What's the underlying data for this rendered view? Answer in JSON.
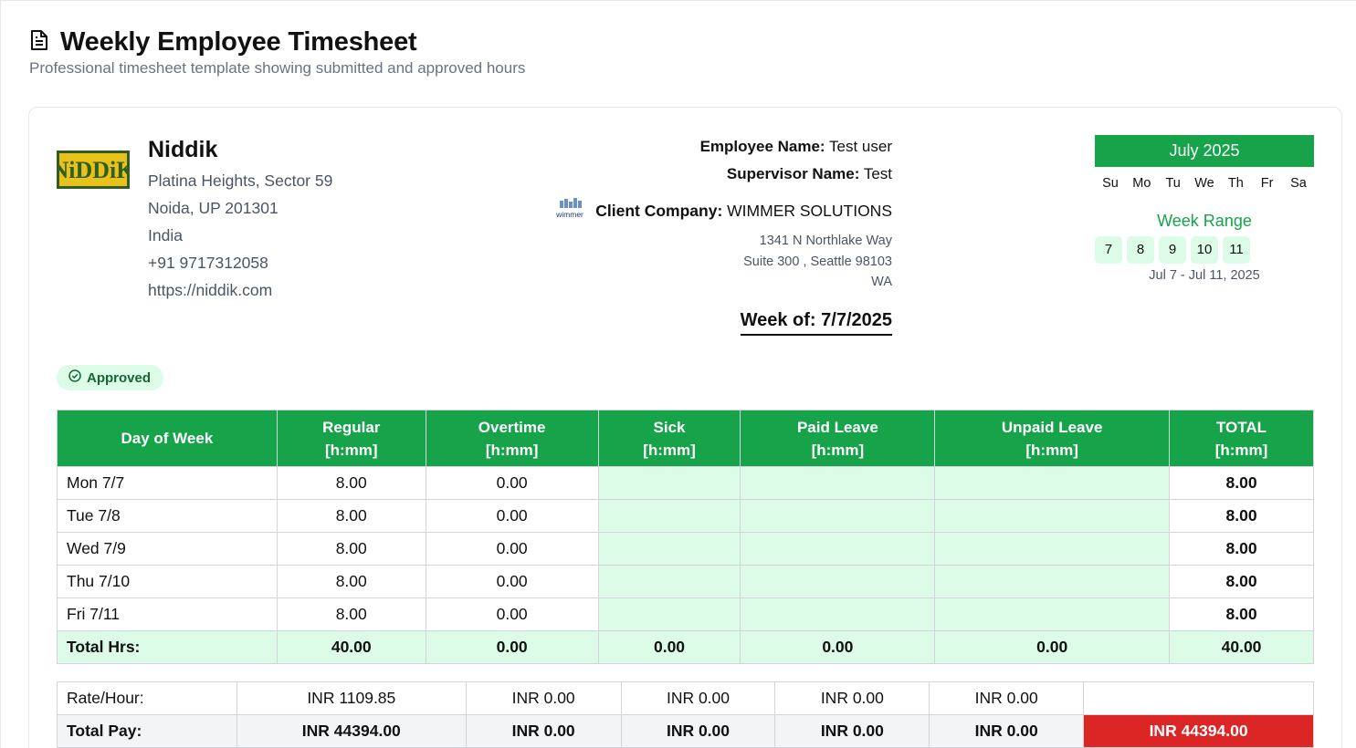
{
  "page": {
    "title": "Weekly Employee Timesheet",
    "subtitle": "Professional timesheet template showing submitted and approved hours",
    "title_icon": "document-icon"
  },
  "company": {
    "logo_text": "NiDDiK",
    "name": "Niddik",
    "address_line1": "Platina Heights, Sector 59",
    "address_line2": "Noida, UP 201301",
    "country": "India",
    "phone": "+91 9717312058",
    "website": "https://niddik.com"
  },
  "employee": {
    "employee_label": "Employee Name:",
    "employee_value": "Test user",
    "supervisor_label": "Supervisor Name:",
    "supervisor_value": "Test",
    "client_label": "Client Company:",
    "client_value": "WIMMER SOLUTIONS",
    "client_logo_text": "wimmer",
    "client_address1": "1341 N Northlake Way",
    "client_address2": "Suite 300 , Seattle 98103",
    "client_address3": "WA",
    "week_of_label": "Week of:",
    "week_of_value": "7/7/2025"
  },
  "calendar": {
    "month": "July 2025",
    "weekdays": [
      "Su",
      "Mo",
      "Tu",
      "We",
      "Th",
      "Fr",
      "Sa"
    ],
    "week_range_label": "Week Range",
    "week_days": [
      "7",
      "8",
      "9",
      "10",
      "11"
    ],
    "range_text": "Jul 7 - Jul 11, 2025"
  },
  "status": {
    "label": "Approved",
    "icon": "check-circle-icon"
  },
  "timesheet": {
    "headers": [
      [
        "Day of Week"
      ],
      [
        "Regular",
        "[h:mm]"
      ],
      [
        "Overtime",
        "[h:mm]"
      ],
      [
        "Sick",
        "[h:mm]"
      ],
      [
        "Paid Leave",
        "[h:mm]"
      ],
      [
        "Unpaid Leave",
        "[h:mm]"
      ],
      [
        "TOTAL",
        "[h:mm]"
      ]
    ],
    "rows": [
      [
        "Mon 7/7",
        "8.00",
        "0.00",
        "",
        "",
        "",
        "8.00"
      ],
      [
        "Tue 7/8",
        "8.00",
        "0.00",
        "",
        "",
        "",
        "8.00"
      ],
      [
        "Wed 7/9",
        "8.00",
        "0.00",
        "",
        "",
        "",
        "8.00"
      ],
      [
        "Thu 7/10",
        "8.00",
        "0.00",
        "",
        "",
        "",
        "8.00"
      ],
      [
        "Fri 7/11",
        "8.00",
        "0.00",
        "",
        "",
        "",
        "8.00"
      ]
    ],
    "totals": [
      "Total Hrs:",
      "40.00",
      "0.00",
      "0.00",
      "0.00",
      "0.00",
      "40.00"
    ]
  },
  "pay": {
    "rate": [
      "Rate/Hour:",
      "INR 1109.85",
      "INR 0.00",
      "INR 0.00",
      "INR 0.00",
      "INR 0.00",
      ""
    ],
    "total": [
      "Total Pay:",
      "INR 44394.00",
      "INR 0.00",
      "INR 0.00",
      "INR 0.00",
      "INR 0.00",
      "INR 44394.00"
    ]
  },
  "colors": {
    "accent_green": "#16a34a",
    "light_green": "#dcfce7",
    "total_red": "#dc2626"
  }
}
